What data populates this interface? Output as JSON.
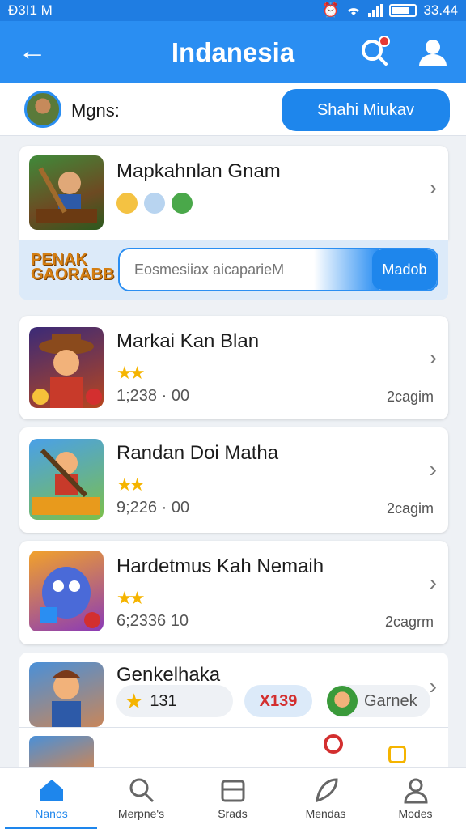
{
  "status": {
    "carrier": "Đ3I1 M",
    "time": "33.44"
  },
  "header": {
    "title": "Indanesia"
  },
  "user": {
    "name": "Mgns:",
    "start_button": "Shahi Miukav"
  },
  "featured": {
    "title": "Mapkahnlan Gnam",
    "banner_logo": "PENAK GAORABB",
    "search_placeholder": "Eosmesiiax aicaparieM",
    "search_button": "Madob"
  },
  "games": [
    {
      "title": "Markai Kan Blan",
      "stars": "★★",
      "number": "1;238 · 00",
      "meta": "2cagim"
    },
    {
      "title": "Randan Doi Matha",
      "stars": "★★",
      "number": "9;226 · 00",
      "meta": "2cagim"
    },
    {
      "title": "Hardetmus Kah Nemaih",
      "stars": "★★",
      "number": "6;2336 10",
      "meta": "2cagrm"
    }
  ],
  "last_card": {
    "title": "Genkelhaka",
    "pill1": "131",
    "pill2": "X139",
    "pill3": "Garnek"
  },
  "tabs": [
    {
      "label": "Nanos"
    },
    {
      "label": "Merpne's"
    },
    {
      "label": "Srads"
    },
    {
      "label": "Mendas"
    },
    {
      "label": "Modes"
    }
  ],
  "colors": {
    "primary": "#2a8ef2",
    "accent_star": "#f5b400",
    "background": "#eef1f5"
  }
}
